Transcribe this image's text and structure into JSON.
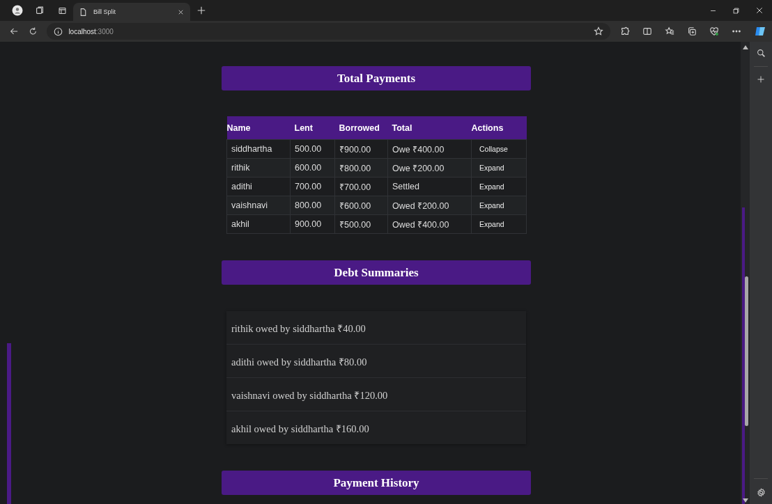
{
  "browser": {
    "tab_title": "Bill Split",
    "url_host": "localhost",
    "url_port": ":3000"
  },
  "total_payments": {
    "title": "Total Payments",
    "columns": [
      "Name",
      "Lent",
      "Borrowed",
      "Total",
      "Actions"
    ],
    "rows": [
      {
        "name": "siddhartha",
        "lent": "500.00",
        "borrowed": "₹900.00",
        "total": "Owe ₹400.00",
        "action": "Collapse"
      },
      {
        "name": "rithik",
        "lent": "600.00",
        "borrowed": "₹800.00",
        "total": "Owe ₹200.00",
        "action": "Expand"
      },
      {
        "name": "adithi",
        "lent": "700.00",
        "borrowed": "₹700.00",
        "total": "Settled",
        "action": "Expand"
      },
      {
        "name": "vaishnavi",
        "lent": "800.00",
        "borrowed": "₹600.00",
        "total": "Owed ₹200.00",
        "action": "Expand"
      },
      {
        "name": "akhil",
        "lent": "900.00",
        "borrowed": "₹500.00",
        "total": "Owed ₹400.00",
        "action": "Expand"
      }
    ]
  },
  "debt_summaries": {
    "title": "Debt Summaries",
    "items": [
      "rithik owed by siddhartha ₹40.00",
      "adithi owed by siddhartha ₹80.00",
      "vaishnavi owed by siddhartha ₹120.00",
      "akhil owed by siddhartha ₹160.00"
    ]
  },
  "payment_history": {
    "title": "Payment History"
  }
}
